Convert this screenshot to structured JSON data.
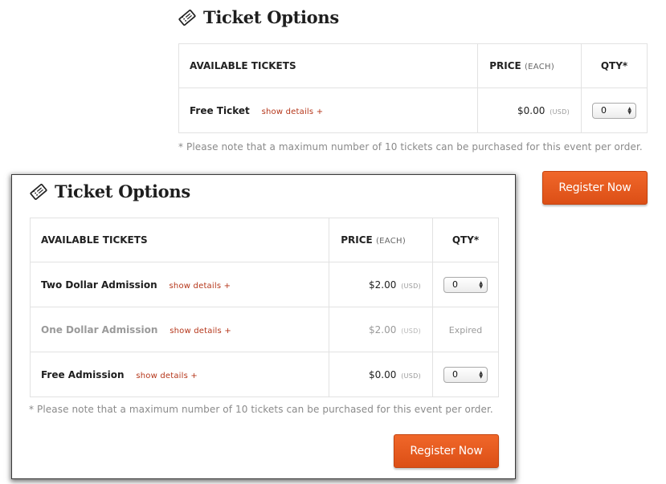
{
  "top": {
    "title": "Ticket Options",
    "headers": {
      "tickets": "AVAILABLE TICKETS",
      "price": "PRICE",
      "price_each": "(EACH)",
      "qty": "QTY*"
    },
    "rows": [
      {
        "name": "Free Ticket",
        "details": "show details +",
        "price": "$0.00",
        "currency": "(USD)",
        "qty": "0"
      }
    ],
    "note": "* Please note that a maximum number of 10 tickets can be purchased for this event per order.",
    "register_label": "Register Now"
  },
  "bottom": {
    "title": "Ticket Options",
    "headers": {
      "tickets": "AVAILABLE TICKETS",
      "price": "PRICE",
      "price_each": "(EACH)",
      "qty": "QTY*"
    },
    "rows": [
      {
        "name": "Two Dollar Admission",
        "details": "show details +",
        "price": "$2.00",
        "currency": "(USD)",
        "qty": "0"
      },
      {
        "name": "One Dollar Admission",
        "details": "show details +",
        "price": "$2.00",
        "currency": "(USD)",
        "status": "Expired"
      },
      {
        "name": "Free Admission",
        "details": "show details +",
        "price": "$0.00",
        "currency": "(USD)",
        "qty": "0"
      }
    ],
    "note": "* Please note that a maximum number of 10 tickets can be purchased for this event per order.",
    "register_label": "Register Now"
  },
  "colors": {
    "accent": "#e05a1c",
    "details_link": "#b5361a",
    "muted_text": "#8a8a8a"
  },
  "icons": {
    "heading": "ticket-icon",
    "select": "select-arrows-icon"
  }
}
